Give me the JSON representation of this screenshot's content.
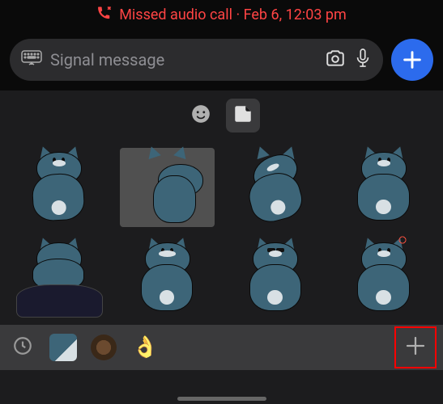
{
  "notification": {
    "icon": "missed-call-icon",
    "text": "Missed audio call · Feb 6, 12:03 pm"
  },
  "composer": {
    "placeholder": "Signal message",
    "keyboard_icon": "keyboard-icon",
    "camera_icon": "camera-icon",
    "mic_icon": "microphone-icon",
    "plus_icon": "plus-icon"
  },
  "sticker_panel": {
    "tabs": [
      {
        "name": "emoji",
        "icon": "emoji-smile-icon",
        "active": false
      },
      {
        "name": "stickers",
        "icon": "sticker-icon",
        "active": true
      }
    ],
    "stickers": [
      {
        "id": "cat-thumbsup",
        "alt": "Blue cat thumbs up"
      },
      {
        "id": "cat-peeking",
        "alt": "Blue cat peeking around corner"
      },
      {
        "id": "cat-laughing",
        "alt": "Blue cat laughing"
      },
      {
        "id": "cat-unamused",
        "alt": "Blue cat unamused standing"
      },
      {
        "id": "cat-sleeping",
        "alt": "Blue cat sleeping in bed"
      },
      {
        "id": "cat-smug",
        "alt": "Blue cat smug grin"
      },
      {
        "id": "cat-cool",
        "alt": "Blue cat sunglasses"
      },
      {
        "id": "cat-angry",
        "alt": "Blue cat angry"
      }
    ],
    "packs": [
      {
        "id": "recent",
        "icon": "clock-icon",
        "label": "Recent"
      },
      {
        "id": "bluecat",
        "label": "Blue Cat pack"
      },
      {
        "id": "lion",
        "label": "Lion pack"
      },
      {
        "id": "hands",
        "label": "Hands pack"
      }
    ],
    "add_pack_icon": "plus-icon",
    "add_pack_highlighted": true
  },
  "colors": {
    "accent": "#2c6bed",
    "alert": "#ff4444",
    "highlight": "#ff0000",
    "cat_fur": "#3d6578",
    "cat_belly": "#d8e0e4"
  }
}
